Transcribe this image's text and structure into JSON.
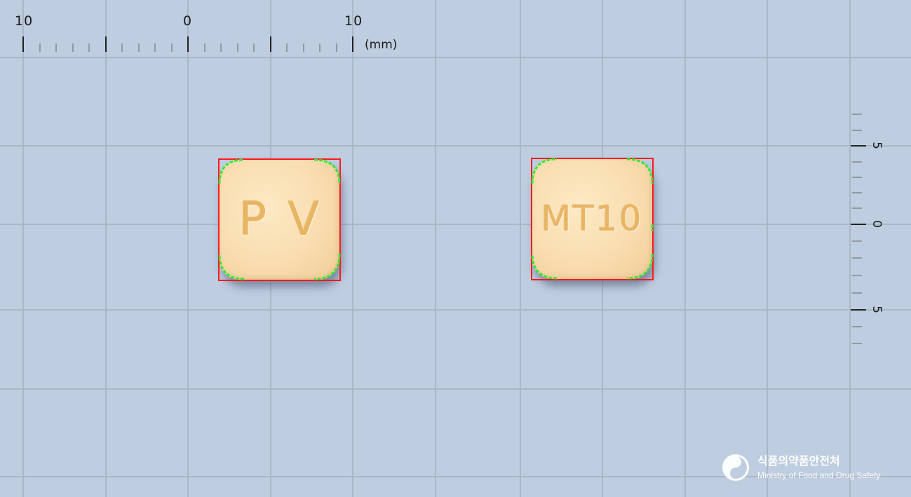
{
  "ruler_top": {
    "labels": [
      "10",
      "0",
      "10"
    ],
    "unit": "(mm)"
  },
  "ruler_right": {
    "labels": [
      "5",
      "0",
      "5"
    ]
  },
  "tablets": [
    {
      "imprint": "PV"
    },
    {
      "imprint": "MT10"
    }
  ],
  "colors": {
    "background": "#bfcde0",
    "grid_line": "#a9b7c9",
    "tablet": "#f9ddb0",
    "imprint": "#e8b562",
    "bounding_box": "#ff1a1a",
    "contour": "#39e639"
  },
  "logo": {
    "korean": "식품의약품안전처",
    "english": "Ministry of Food and Drug Safety",
    "icon": "mfds-emblem-icon"
  }
}
